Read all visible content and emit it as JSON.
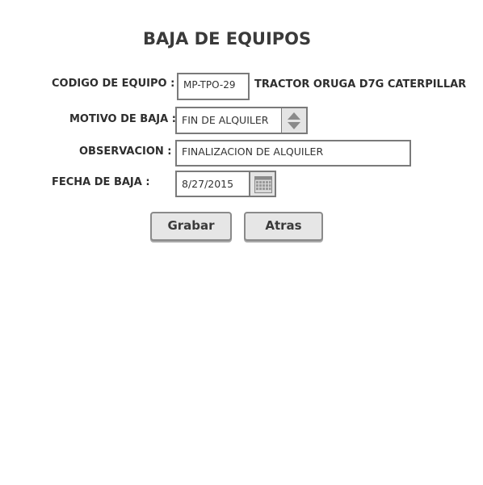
{
  "page": {
    "title": "BAJA DE EQUIPOS"
  },
  "form": {
    "codigo_label": "CODIGO DE EQUIPO :",
    "codigo_value": "MP-TPO-29",
    "equipo_descripcion": "TRACTOR ORUGA D7G CATERPILLAR",
    "motivo_label": "MOTIVO DE BAJA :",
    "motivo_value": "FIN DE ALQUILER",
    "observacion_label": "OBSERVACION :",
    "observacion_value": "FINALIZACION DE ALQUILER",
    "fecha_label": "FECHA DE BAJA :",
    "fecha_value": "8/27/2015"
  },
  "actions": {
    "grabar_label": "Grabar",
    "atras_label": "Atras"
  },
  "icons": {
    "spinner": "up-down-arrows-icon",
    "calendar": "calendar-icon"
  }
}
